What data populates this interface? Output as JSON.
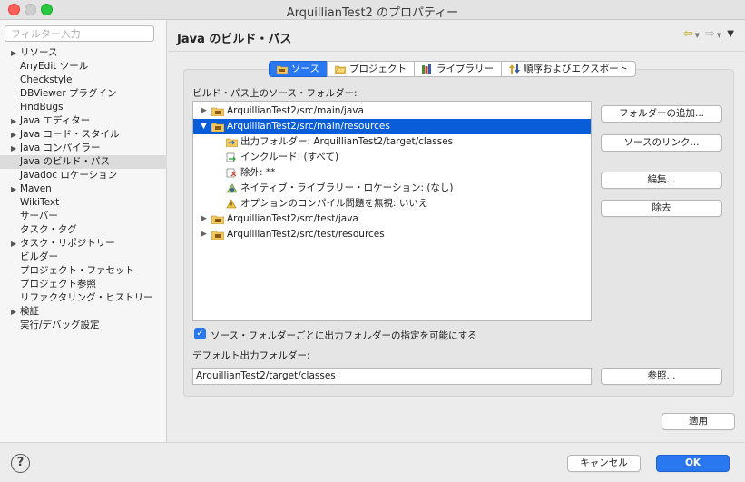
{
  "window": {
    "title": "ArquillianTest2 のプロパティー"
  },
  "sidebar": {
    "filter_placeholder": "フィルター入力",
    "items": [
      {
        "label": "リソース",
        "expandable": true
      },
      {
        "label": "AnyEdit ツール",
        "expandable": false
      },
      {
        "label": "Checkstyle",
        "expandable": false
      },
      {
        "label": "DBViewer プラグイン",
        "expandable": false
      },
      {
        "label": "FindBugs",
        "expandable": false
      },
      {
        "label": "Java エディター",
        "expandable": true
      },
      {
        "label": "Java コード・スタイル",
        "expandable": true
      },
      {
        "label": "Java コンパイラー",
        "expandable": true
      },
      {
        "label": "Java のビルド・パス",
        "expandable": false,
        "selected": true
      },
      {
        "label": "Javadoc ロケーション",
        "expandable": false
      },
      {
        "label": "Maven",
        "expandable": true
      },
      {
        "label": "WikiText",
        "expandable": false
      },
      {
        "label": "サーバー",
        "expandable": false
      },
      {
        "label": "タスク・タグ",
        "expandable": false
      },
      {
        "label": "タスク・リポジトリー",
        "expandable": true
      },
      {
        "label": "ビルダー",
        "expandable": false
      },
      {
        "label": "プロジェクト・ファセット",
        "expandable": false
      },
      {
        "label": "プロジェクト参照",
        "expandable": false
      },
      {
        "label": "リファクタリング・ヒストリー",
        "expandable": false
      },
      {
        "label": "検証",
        "expandable": true
      },
      {
        "label": "実行/デバッグ設定",
        "expandable": false
      }
    ]
  },
  "header": {
    "title": "Java のビルド・パス"
  },
  "tabs": [
    {
      "label": "ソース",
      "active": true,
      "icon": "source-folder-icon"
    },
    {
      "label": "プロジェクト",
      "active": false,
      "icon": "project-folder-icon"
    },
    {
      "label": "ライブラリー",
      "active": false,
      "icon": "library-icon"
    },
    {
      "label": "順序およびエクスポート",
      "active": false,
      "icon": "order-export-icon"
    }
  ],
  "source": {
    "section_label": "ビルド・パス上のソース・フォルダー:",
    "tree": {
      "folder_main_java": "ArquillianTest2/src/main/java",
      "folder_main_resources": "ArquillianTest2/src/main/resources",
      "output_folder": "出力フォルダー: ArquillianTest2/target/classes",
      "included": "インクルード: (すべて)",
      "excluded": "除外: **",
      "native_location": "ネイティブ・ライブラリー・ロケーション: (なし)",
      "ignore_problems": "オプションのコンパイル問題を無視: いいえ",
      "folder_test_java": "ArquillianTest2/src/test/java",
      "folder_test_resources": "ArquillianTest2/src/test/resources"
    },
    "buttons": {
      "add_folder": "フォルダーの追加...",
      "link_source": "ソースのリンク...",
      "edit": "編集...",
      "remove": "除去"
    },
    "allow_output_checkbox": {
      "label": "ソース・フォルダーごとに出力フォルダーの指定を可能にする",
      "checked": true
    },
    "default_output_label": "デフォルト出力フォルダー:",
    "default_output_value": "ArquillianTest2/target/classes",
    "browse_button": "参照..."
  },
  "footer": {
    "apply": "適用",
    "cancel": "キャンセル",
    "ok": "OK",
    "help_icon": "?"
  },
  "colors": {
    "accent": "#2a78f0",
    "selection": "#0a5dd8",
    "folder": "#e8b84a"
  }
}
